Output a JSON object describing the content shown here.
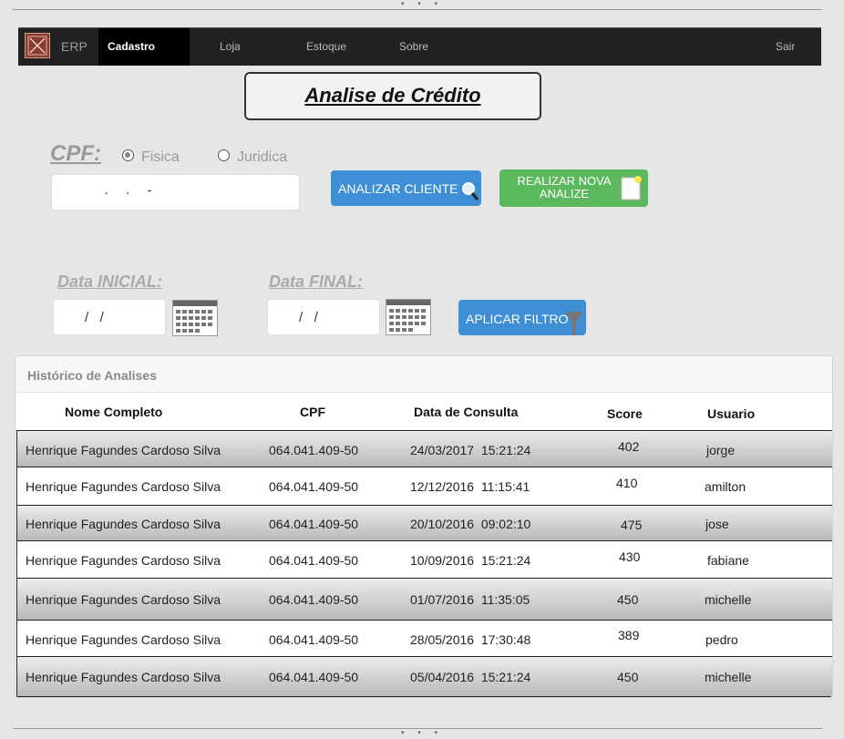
{
  "nav": {
    "brand": "ERP",
    "items": [
      {
        "label": "Cadastro",
        "active": true
      },
      {
        "label": "Loja",
        "active": false
      },
      {
        "label": "Estoque",
        "active": false
      },
      {
        "label": "Sobre",
        "active": false
      }
    ],
    "logout": "Sair"
  },
  "page_title": "Analise de Crédito",
  "cpf": {
    "label": "CPF:",
    "options": [
      {
        "label": "Fisica",
        "selected": true
      },
      {
        "label": "Juridica",
        "selected": false
      }
    ],
    "value": "   .   .   -"
  },
  "buttons": {
    "analyze": "ANALIZAR CLIENTE",
    "new_analysis_line1": "REALIZAR NOVA",
    "new_analysis_line2": "ANALIZE",
    "apply_filter": "APLICAR FILTRO"
  },
  "filters": {
    "start_label": "Data INICIAL:",
    "start_value": "/   /",
    "end_label": "Data FINAL:",
    "end_value": "/   /"
  },
  "history": {
    "title": "Histórico de Analises",
    "columns": [
      "Nome Completo",
      "CPF",
      "Data de Consulta",
      "Score",
      "Usuario"
    ],
    "rows": [
      {
        "name": "Henrique Fagundes Cardoso Silva",
        "cpf": "064.041.409-50",
        "date": "24/03/2017  15:21:24",
        "score": "402",
        "user": "jorge"
      },
      {
        "name": "Henrique Fagundes Cardoso Silva",
        "cpf": "064.041.409-50",
        "date": "12/12/2016  11:15:41",
        "score": "410",
        "user": "amilton"
      },
      {
        "name": "Henrique Fagundes Cardoso Silva",
        "cpf": "064.041.409-50",
        "date": "20/10/2016  09:02:10",
        "score": "475",
        "user": "jose"
      },
      {
        "name": "Henrique Fagundes Cardoso Silva",
        "cpf": "064.041.409-50",
        "date": "10/09/2016  15:21:24",
        "score": "430",
        "user": "fabiane"
      },
      {
        "name": "Henrique Fagundes Cardoso Silva",
        "cpf": "064.041.409-50",
        "date": "01/07/2016  11:35:05",
        "score": "450",
        "user": "michelle"
      },
      {
        "name": "Henrique Fagundes Cardoso Silva",
        "cpf": "064.041.409-50",
        "date": "28/05/2016  17:30:48",
        "score": "389",
        "user": "pedro"
      },
      {
        "name": "Henrique Fagundes Cardoso Silva",
        "cpf": "064.041.409-50",
        "date": "05/04/2016  15:21:24",
        "score": "450",
        "user": "michelle"
      }
    ]
  },
  "colors": {
    "navbar": "#222222",
    "primary_button": "#3f8fd6",
    "success_button": "#5cb85c"
  }
}
